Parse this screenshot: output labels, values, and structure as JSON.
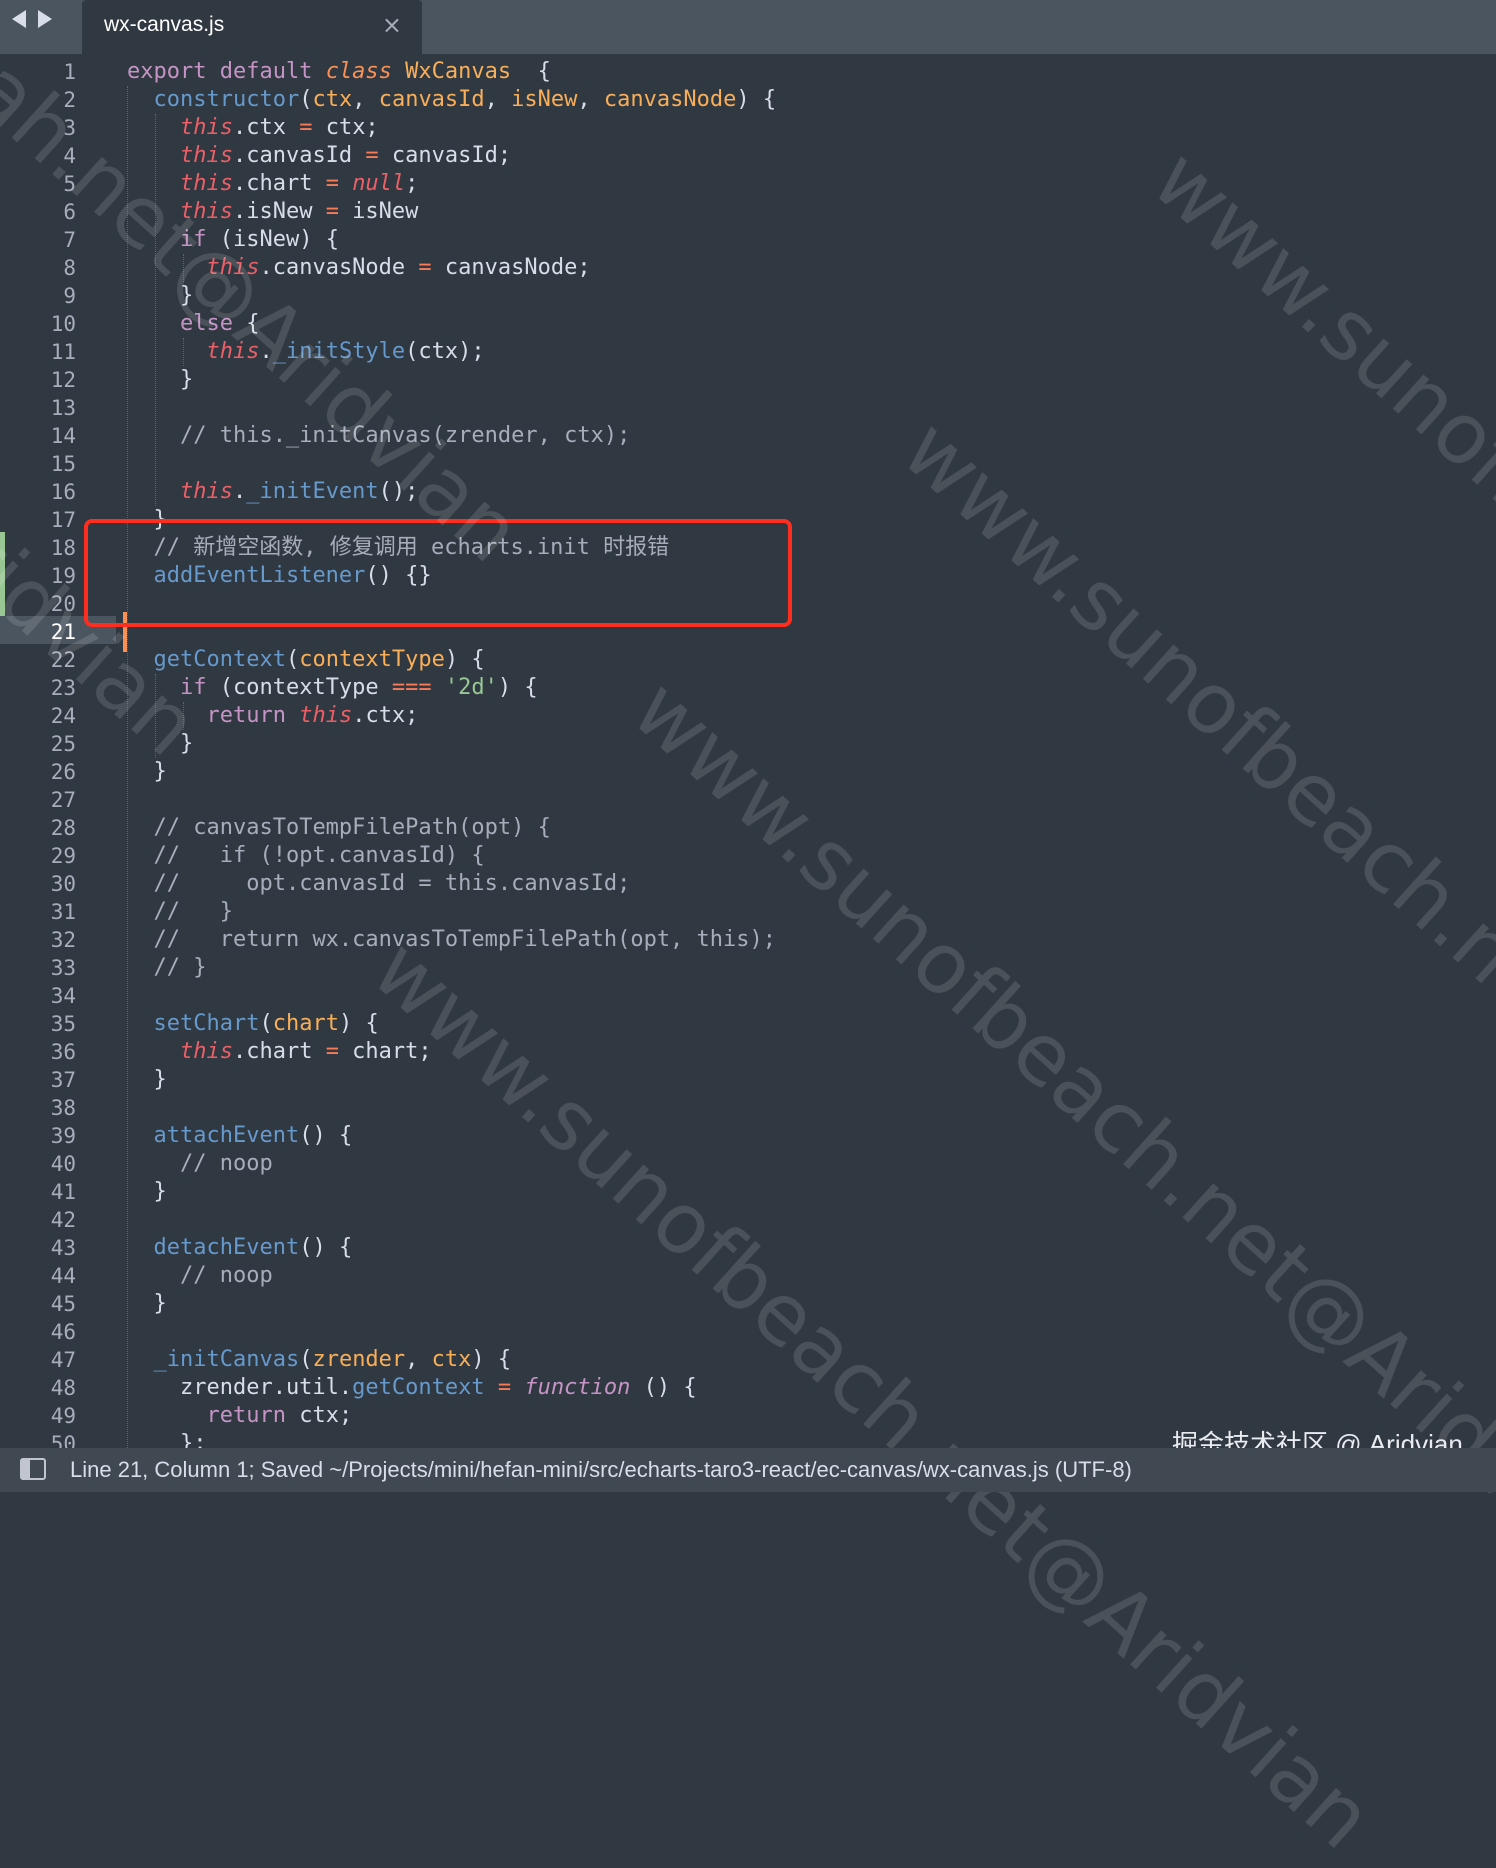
{
  "tab": {
    "title": "wx-canvas.js",
    "close_glyph": "×"
  },
  "editor": {
    "current_line": 21,
    "line_numbers": [
      "1",
      "2",
      "3",
      "4",
      "5",
      "6",
      "7",
      "8",
      "9",
      "10",
      "11",
      "12",
      "13",
      "14",
      "15",
      "16",
      "17",
      "18",
      "19",
      "20",
      "21",
      "22",
      "23",
      "24",
      "25",
      "26",
      "27",
      "28",
      "29",
      "30",
      "31",
      "32",
      "33",
      "34",
      "35",
      "36",
      "37",
      "38",
      "39",
      "40",
      "41",
      "42",
      "43",
      "44",
      "45",
      "46",
      "47",
      "48",
      "49",
      "50"
    ],
    "lines": [
      [
        [
          "kw",
          "export default "
        ],
        [
          "cls",
          "class "
        ],
        [
          "cn",
          "WxCanvas"
        ],
        [
          "",
          "  {"
        ]
      ],
      [
        [
          "",
          "  "
        ],
        [
          "fn",
          "constructor"
        ],
        [
          "",
          "("
        ],
        [
          "pa",
          "ctx"
        ],
        [
          "",
          ", "
        ],
        [
          "pa",
          "canvasId"
        ],
        [
          "",
          ", "
        ],
        [
          "pa",
          "isNew"
        ],
        [
          "",
          ", "
        ],
        [
          "pa",
          "canvasNode"
        ],
        [
          "",
          ") {"
        ]
      ],
      [
        [
          "",
          "    "
        ],
        [
          "th",
          "this"
        ],
        [
          "",
          ".ctx "
        ],
        [
          "op",
          "="
        ],
        [
          "",
          " ctx;"
        ]
      ],
      [
        [
          "",
          "    "
        ],
        [
          "th",
          "this"
        ],
        [
          "",
          ".canvasId "
        ],
        [
          "op",
          "="
        ],
        [
          "",
          " canvasId;"
        ]
      ],
      [
        [
          "",
          "    "
        ],
        [
          "th",
          "this"
        ],
        [
          "",
          ".chart "
        ],
        [
          "op",
          "="
        ],
        [
          "",
          " "
        ],
        [
          "nl",
          "null"
        ],
        [
          "",
          ";"
        ]
      ],
      [
        [
          "",
          "    "
        ],
        [
          "th",
          "this"
        ],
        [
          "",
          ".isNew "
        ],
        [
          "op",
          "="
        ],
        [
          "",
          " isNew"
        ]
      ],
      [
        [
          "",
          "    "
        ],
        [
          "kw",
          "if"
        ],
        [
          "",
          " (isNew) {"
        ]
      ],
      [
        [
          "",
          "      "
        ],
        [
          "th",
          "this"
        ],
        [
          "",
          ".canvasNode "
        ],
        [
          "op",
          "="
        ],
        [
          "",
          " canvasNode;"
        ]
      ],
      [
        [
          "",
          "    }"
        ]
      ],
      [
        [
          "",
          "    "
        ],
        [
          "kw",
          "else"
        ],
        [
          "",
          " {"
        ]
      ],
      [
        [
          "",
          "      "
        ],
        [
          "th",
          "this"
        ],
        [
          "",
          "."
        ],
        [
          "fn",
          "_initStyle"
        ],
        [
          "",
          "(ctx);"
        ]
      ],
      [
        [
          "",
          "    }"
        ]
      ],
      [
        [
          "",
          ""
        ]
      ],
      [
        [
          "",
          "    "
        ],
        [
          "cm",
          "// this._initCanvas(zrender, ctx);"
        ]
      ],
      [
        [
          "",
          ""
        ]
      ],
      [
        [
          "",
          "    "
        ],
        [
          "th",
          "this"
        ],
        [
          "",
          "."
        ],
        [
          "fn",
          "_initEvent"
        ],
        [
          "",
          "();"
        ]
      ],
      [
        [
          "",
          "  }"
        ]
      ],
      [
        [
          "",
          "  "
        ],
        [
          "cm",
          "// 新增空函数, 修复调用 echarts.init 时报错"
        ]
      ],
      [
        [
          "",
          "  "
        ],
        [
          "fn",
          "addEventListener"
        ],
        [
          "",
          "() {}"
        ]
      ],
      [
        [
          "",
          ""
        ]
      ],
      [
        [
          "",
          ""
        ]
      ],
      [
        [
          "",
          "  "
        ],
        [
          "fn",
          "getContext"
        ],
        [
          "",
          "("
        ],
        [
          "pa",
          "contextType"
        ],
        [
          "",
          ") {"
        ]
      ],
      [
        [
          "",
          "    "
        ],
        [
          "kw",
          "if"
        ],
        [
          "",
          " (contextType "
        ],
        [
          "op",
          "==="
        ],
        [
          "",
          " "
        ],
        [
          "st",
          "'2d'"
        ],
        [
          "",
          ") {"
        ]
      ],
      [
        [
          "",
          "      "
        ],
        [
          "kw",
          "return"
        ],
        [
          "",
          " "
        ],
        [
          "th",
          "this"
        ],
        [
          "",
          ".ctx;"
        ]
      ],
      [
        [
          "",
          "    }"
        ]
      ],
      [
        [
          "",
          "  }"
        ]
      ],
      [
        [
          "",
          ""
        ]
      ],
      [
        [
          "",
          "  "
        ],
        [
          "cm",
          "// canvasToTempFilePath(opt) {"
        ]
      ],
      [
        [
          "",
          "  "
        ],
        [
          "cm",
          "//   if (!opt.canvasId) {"
        ]
      ],
      [
        [
          "",
          "  "
        ],
        [
          "cm",
          "//     opt.canvasId = this.canvasId;"
        ]
      ],
      [
        [
          "",
          "  "
        ],
        [
          "cm",
          "//   }"
        ]
      ],
      [
        [
          "",
          "  "
        ],
        [
          "cm",
          "//   return wx.canvasToTempFilePath(opt, this);"
        ]
      ],
      [
        [
          "",
          "  "
        ],
        [
          "cm",
          "// }"
        ]
      ],
      [
        [
          "",
          ""
        ]
      ],
      [
        [
          "",
          "  "
        ],
        [
          "fn",
          "setChart"
        ],
        [
          "",
          "("
        ],
        [
          "pa",
          "chart"
        ],
        [
          "",
          ") {"
        ]
      ],
      [
        [
          "",
          "    "
        ],
        [
          "th",
          "this"
        ],
        [
          "",
          ".chart "
        ],
        [
          "op",
          "="
        ],
        [
          "",
          " chart;"
        ]
      ],
      [
        [
          "",
          "  }"
        ]
      ],
      [
        [
          "",
          ""
        ]
      ],
      [
        [
          "",
          "  "
        ],
        [
          "fn",
          "attachEvent"
        ],
        [
          "",
          "() {"
        ]
      ],
      [
        [
          "",
          "    "
        ],
        [
          "cm",
          "// noop"
        ]
      ],
      [
        [
          "",
          "  }"
        ]
      ],
      [
        [
          "",
          ""
        ]
      ],
      [
        [
          "",
          "  "
        ],
        [
          "fn",
          "detachEvent"
        ],
        [
          "",
          "() {"
        ]
      ],
      [
        [
          "",
          "    "
        ],
        [
          "cm",
          "// noop"
        ]
      ],
      [
        [
          "",
          "  }"
        ]
      ],
      [
        [
          "",
          ""
        ]
      ],
      [
        [
          "",
          "  "
        ],
        [
          "fn",
          "_initCanvas"
        ],
        [
          "",
          "("
        ],
        [
          "pa",
          "zrender"
        ],
        [
          "",
          ", "
        ],
        [
          "pa",
          "ctx"
        ],
        [
          "",
          ") {"
        ]
      ],
      [
        [
          "",
          "    zrender.util."
        ],
        [
          "fn",
          "getContext"
        ],
        [
          "",
          " "
        ],
        [
          "op",
          "="
        ],
        [
          "",
          " "
        ],
        [
          "fnkw",
          "function"
        ],
        [
          "",
          " () {"
        ]
      ],
      [
        [
          "",
          "      "
        ],
        [
          "kw",
          "return"
        ],
        [
          "",
          " ctx;"
        ]
      ],
      [
        [
          "",
          "    };"
        ]
      ]
    ]
  },
  "watermark": {
    "texts": [
      "ah.net@Aridvian",
      "www.sunofbeach.net@Aridvian",
      "www.sunofbeach.net@Aridvian",
      "www.sunofbeach.net@Aridvian",
      "www.sunofbeach.net@Aridvian",
      "Aridvian"
    ]
  },
  "credit": "掘金技术社区 @ Aridvian",
  "status": {
    "text": "Line 21, Column 1; Saved ~/Projects/mini/hefan-mini/src/echarts-taro3-react/ec-canvas/wx-canvas.js (UTF-8)"
  }
}
